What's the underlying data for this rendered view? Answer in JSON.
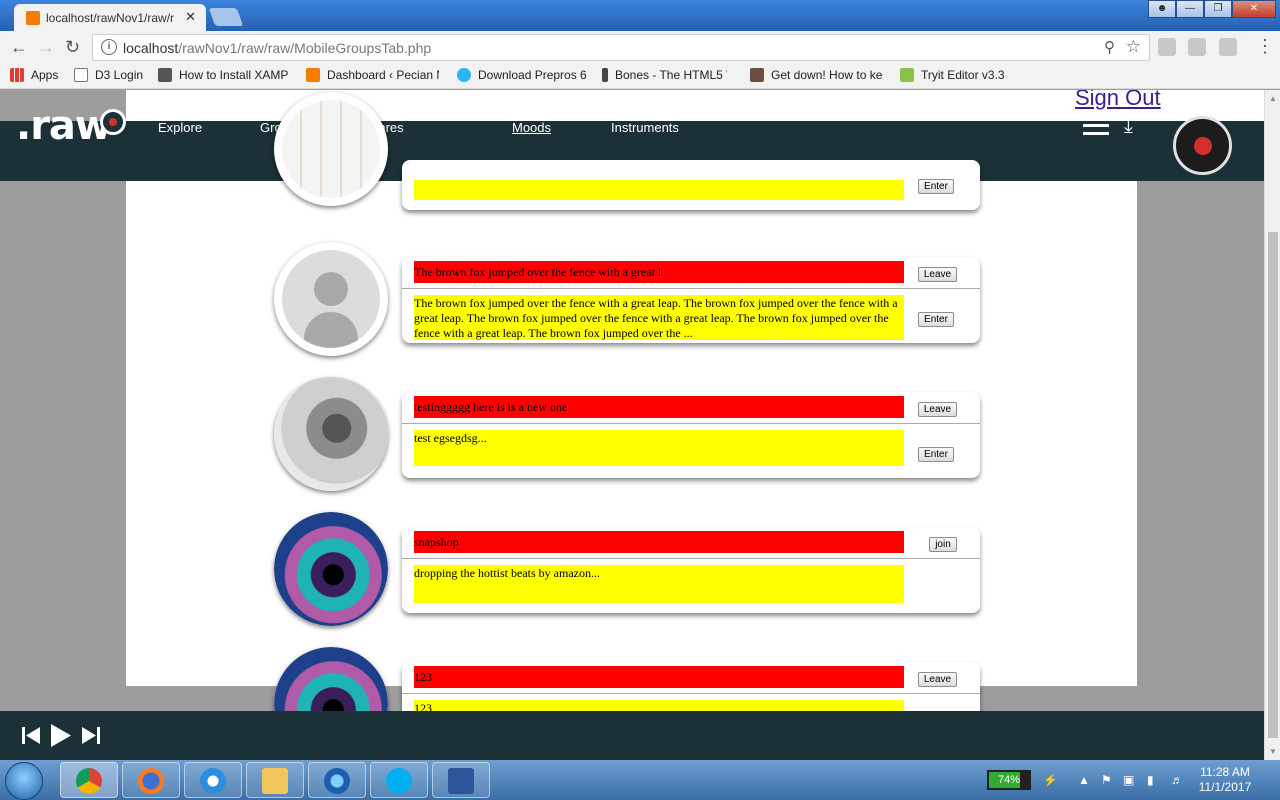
{
  "browser": {
    "tab_title": "localhost/rawNov1/raw/r",
    "tab_close": "✕",
    "url_host": "localhost",
    "url_path": "/rawNov1/raw/raw/MobileGroupsTab.php"
  },
  "bookmarks": [
    {
      "label": "Apps",
      "color": "#e53935"
    },
    {
      "label": "D3 Login",
      "color": "#ffffff"
    },
    {
      "label": "How to Install XAMP",
      "color": "#555555"
    },
    {
      "label": "Dashboard ‹ Pecian M",
      "color": "#f57c00"
    },
    {
      "label": "Download Prepros 6",
      "color": "#29b6f6"
    },
    {
      "label": "Bones - The HTML5 V",
      "color": "#444444"
    },
    {
      "label": "Get down! How to ke",
      "color": "#6d4c41"
    },
    {
      "label": "Tryit Editor v3.3",
      "color": "#8bc34a"
    }
  ],
  "site": {
    "logo": ".raw",
    "sign_out": "Sign Out",
    "nav": [
      "Explore",
      "Groups",
      "Genres",
      "Moods",
      "Instruments"
    ],
    "active_nav": "Moods"
  },
  "groups": [
    {
      "title": "",
      "description": "",
      "primary_button": "",
      "secondary_button": "Enter",
      "avatar": "screenshot-thumbnail"
    },
    {
      "title": "The brown fox jumped over the fence with a great l",
      "description": "The brown fox jumped over the fence with a great leap. The brown fox jumped over the fence with a great leap. The brown fox jumped over the fence with a great leap. The brown fox jumped over the fence with a great leap. The brown fox jumped over the ...",
      "primary_button": "Leave",
      "secondary_button": "Enter",
      "avatar": "default-user"
    },
    {
      "title": "testinggggg here is is a new one",
      "description": "test egsegdsg...",
      "primary_button": "Leave",
      "secondary_button": "Enter",
      "avatar": "bird-photo"
    },
    {
      "title": "snapshop",
      "description": "dropping the hottist beats by amazon...",
      "primary_button": "join",
      "secondary_button": "",
      "avatar": "nebula-art"
    },
    {
      "title": "123",
      "description": "123",
      "primary_button": "Leave",
      "secondary_button": "",
      "avatar": "nebula-art"
    }
  ],
  "tray": {
    "battery": "74%",
    "battery_level": 0.74,
    "time": "11:28 AM",
    "date": "11/1/2017"
  },
  "colors": {
    "header_bg": "#1c3038",
    "title_bar": "#ff0000",
    "desc_bar": "#ffff00",
    "record_accent": "#d32f2f"
  }
}
